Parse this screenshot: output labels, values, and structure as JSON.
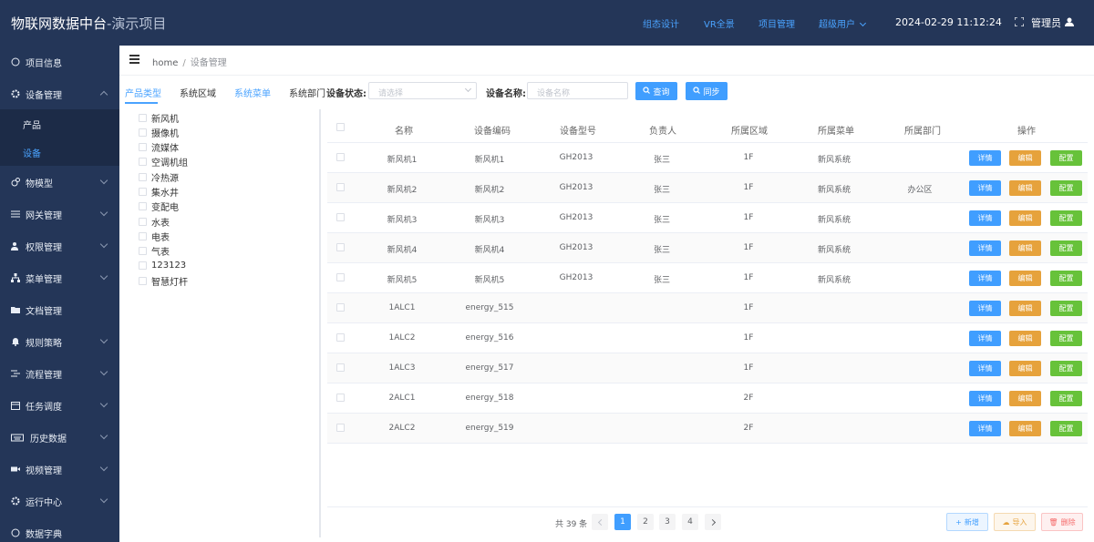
{
  "header": {
    "title": "物联网数据中台",
    "subtitle": "-演示项目",
    "nav": [
      "组态设计",
      "VR全景",
      "项目管理",
      "超级用户"
    ],
    "datetime": "2024-02-29 11:12:24",
    "user": "管理员"
  },
  "sidebar": {
    "items": [
      {
        "label": "项目信息",
        "icon": "info-icon"
      },
      {
        "label": "设备管理",
        "icon": "gear-icon"
      },
      {
        "label": "物模型",
        "icon": "gears-icon"
      },
      {
        "label": "网关管理",
        "icon": "sliders-icon"
      },
      {
        "label": "权限管理",
        "icon": "users-icon"
      },
      {
        "label": "菜单管理",
        "icon": "sitemap-icon"
      },
      {
        "label": "文档管理",
        "icon": "folder-icon"
      },
      {
        "label": "规则策略",
        "icon": "bell-icon"
      },
      {
        "label": "流程管理",
        "icon": "flow-icon"
      },
      {
        "label": "任务调度",
        "icon": "calendar-icon"
      },
      {
        "label": "历史数据",
        "icon": "keyboard-icon"
      },
      {
        "label": "视频管理",
        "icon": "video-icon"
      },
      {
        "label": "运行中心",
        "icon": "cog-icon"
      },
      {
        "label": "数据字典",
        "icon": "book-icon"
      }
    ],
    "sub_items": [
      {
        "label": "产品",
        "active": false
      },
      {
        "label": "设备",
        "active": true
      }
    ]
  },
  "breadcrumb": {
    "home": "home",
    "separator": "/",
    "current": "设备管理"
  },
  "filters": {
    "tabs": [
      "产品类型",
      "系统区域",
      "系统菜单",
      "系统部门"
    ],
    "status_label": "设备状态:",
    "status_placeholder": "请选择",
    "name_label": "设备名称:",
    "name_placeholder": "设备名称",
    "query_button": "查询",
    "sync_button": "同步"
  },
  "tree": [
    "新风机",
    "摄像机",
    "流媒体",
    "空调机组",
    "冷热源",
    "集水井",
    "变配电",
    "水表",
    "电表",
    "气表",
    "123123",
    "智慧灯杆"
  ],
  "table": {
    "columns": [
      "名称",
      "设备编码",
      "设备型号",
      "负责人",
      "所属区域",
      "所属菜单",
      "所属部门",
      "操作"
    ],
    "rows": [
      {
        "name": "新风机1",
        "code": "新风机1",
        "model": "GH2013",
        "owner": "张三",
        "area": "1F",
        "menu": "新风系统",
        "dept": ""
      },
      {
        "name": "新风机2",
        "code": "新风机2",
        "model": "GH2013",
        "owner": "张三",
        "area": "1F",
        "menu": "新风系统",
        "dept": "办公区"
      },
      {
        "name": "新风机3",
        "code": "新风机3",
        "model": "GH2013",
        "owner": "张三",
        "area": "1F",
        "menu": "新风系统",
        "dept": ""
      },
      {
        "name": "新风机4",
        "code": "新风机4",
        "model": "GH2013",
        "owner": "张三",
        "area": "1F",
        "menu": "新风系统",
        "dept": ""
      },
      {
        "name": "新风机5",
        "code": "新风机5",
        "model": "GH2013",
        "owner": "张三",
        "area": "1F",
        "menu": "新风系统",
        "dept": ""
      },
      {
        "name": "1ALC1",
        "code": "energy_515",
        "model": "",
        "owner": "",
        "area": "1F",
        "menu": "",
        "dept": ""
      },
      {
        "name": "1ALC2",
        "code": "energy_516",
        "model": "",
        "owner": "",
        "area": "1F",
        "menu": "",
        "dept": ""
      },
      {
        "name": "1ALC3",
        "code": "energy_517",
        "model": "",
        "owner": "",
        "area": "1F",
        "menu": "",
        "dept": ""
      },
      {
        "name": "2ALC1",
        "code": "energy_518",
        "model": "",
        "owner": "",
        "area": "2F",
        "menu": "",
        "dept": ""
      },
      {
        "name": "2ALC2",
        "code": "energy_519",
        "model": "",
        "owner": "",
        "area": "2F",
        "menu": "",
        "dept": ""
      }
    ],
    "actions": {
      "detail": "详情",
      "edit": "编辑",
      "config": "配置"
    }
  },
  "pagination": {
    "total": "共 39 条",
    "pages": [
      "1",
      "2",
      "3",
      "4"
    ],
    "current": "1"
  },
  "footer_buttons": {
    "add": "新增",
    "import": "导入",
    "delete": "删除"
  },
  "colors": {
    "sidebar": "#243658",
    "primary": "#409eff",
    "warning": "#e6a23c",
    "success": "#67c23a",
    "danger": "#f56c6c"
  }
}
